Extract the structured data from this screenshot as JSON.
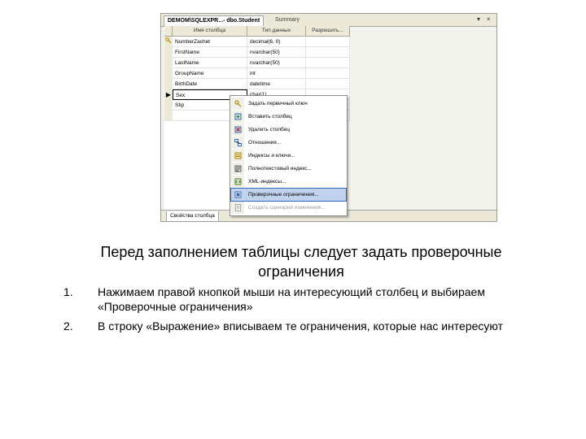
{
  "screenshot": {
    "tabs": {
      "active": "DEMOM\\SQLEXPR...- dbo.Student",
      "inactive": "Summary"
    },
    "window_buttons": [
      "▾",
      "×"
    ],
    "columns": [
      "Имя столбца",
      "Тип данных",
      "Разрешить..."
    ],
    "rows": [
      {
        "marker": "key-icon",
        "name": "NumberZachet",
        "type": "decimal(6, 0)",
        "nullable": false
      },
      {
        "marker": "",
        "name": "FirstName",
        "type": "nvarchar(50)",
        "nullable": false
      },
      {
        "marker": "",
        "name": "LastName",
        "type": "nvarchar(50)",
        "nullable": false
      },
      {
        "marker": "",
        "name": "GroupName",
        "type": "int",
        "nullable": false
      },
      {
        "marker": "",
        "name": "BirthDate",
        "type": "datetime",
        "nullable": false
      },
      {
        "marker": "▶",
        "name": "Sex",
        "type": "char(1)",
        "nullable": false
      },
      {
        "marker": "",
        "name": "Stip",
        "type": "",
        "nullable": null
      }
    ],
    "properties_tab": "Свойства столбца",
    "context_menu": [
      {
        "icon": "key-icon",
        "label": "Задать первичный ключ",
        "state": "normal"
      },
      {
        "icon": "insert-column-icon",
        "label": "Вставить столбец",
        "state": "normal"
      },
      {
        "icon": "delete-column-icon",
        "label": "Удалить столбец",
        "state": "normal"
      },
      {
        "icon": "relationships-icon",
        "label": "Отношения...",
        "state": "normal"
      },
      {
        "icon": "indexes-icon",
        "label": "Индексы и ключи...",
        "state": "normal"
      },
      {
        "icon": "fulltext-index-icon",
        "label": "Полнотекстовый индекс...",
        "state": "normal"
      },
      {
        "icon": "xml-index-icon",
        "label": "XML-индексы...",
        "state": "normal"
      },
      {
        "icon": "check-constraints-icon",
        "label": "Проверочные ограничения...",
        "state": "highlighted"
      },
      {
        "icon": "generate-script-icon",
        "label": "Создать сценарий изменения...",
        "state": "disabled"
      }
    ]
  },
  "caption": "Перед заполнением таблицы следует задать проверочные ограничения",
  "steps": [
    {
      "number": "1.",
      "text": "Нажимаем правой кнопкой мыши на интересующий столбец и выбираем «Проверочные ограничения»"
    },
    {
      "number": "2.",
      "text": "В строку «Выражение» вписываем те ограничения, которые нас интересуют"
    }
  ],
  "colors": {
    "menu_highlight": "#c1d2ee",
    "checkbox_border": "#1c4b96",
    "chrome": "#ece9d8"
  }
}
